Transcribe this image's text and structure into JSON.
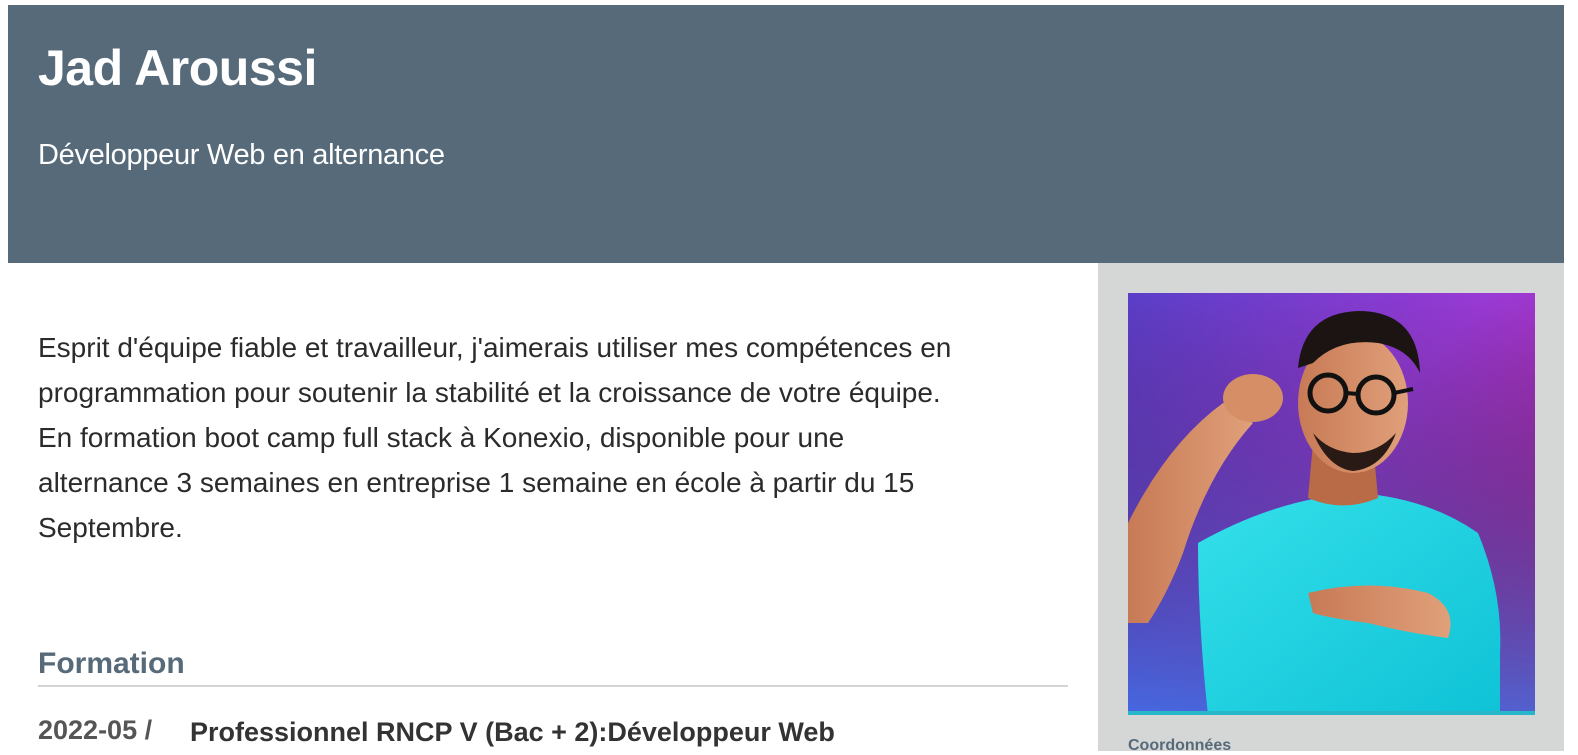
{
  "header": {
    "name": "Jad Aroussi",
    "title": "Développeur Web en alternance",
    "background_color": "#566a79"
  },
  "summary": {
    "text": "Esprit d'équipe fiable et travailleur, j'aimerais utiliser mes compétences en programmation pour soutenir la stabilité et la croissance de votre équipe. En formation boot camp full stack à Konexio, disponible pour une alternance 3 semaines en entreprise 1 semaine en école à partir du 15 Septembre."
  },
  "formation": {
    "heading": "Formation",
    "entries": [
      {
        "date": "2022-05 /",
        "title": "Professionnel RNCP V (Bac + 2):Développeur Web"
      }
    ]
  },
  "sidebar": {
    "photo_icon": "profile-photo",
    "section_label": "Coordonnées",
    "background_color": "#d5d6d6"
  }
}
